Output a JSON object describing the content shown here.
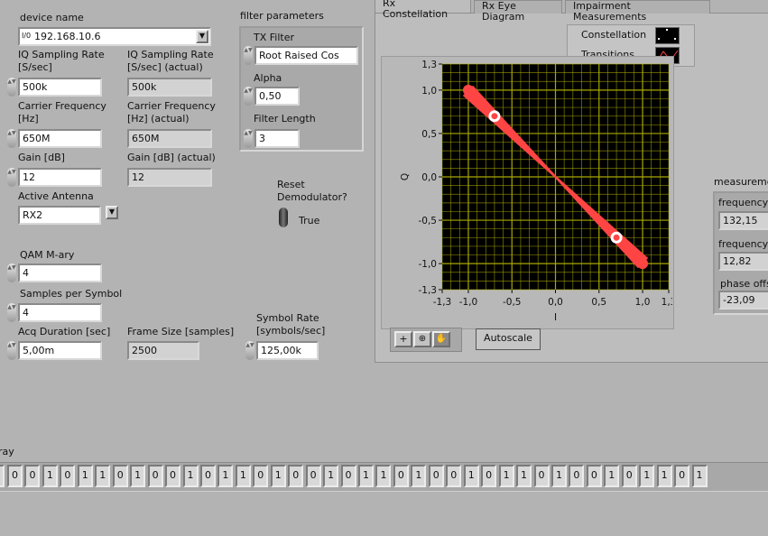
{
  "device": {
    "label": "device name",
    "value": "192.168.10.6",
    "io_icon": "visa-io-icon"
  },
  "iq_rate": {
    "label": "IQ Sampling Rate [S/sec]",
    "value": "500k"
  },
  "iq_rate_actual": {
    "label": "IQ Sampling Rate [S/sec] (actual)",
    "value": "500k"
  },
  "carrier": {
    "label": "Carrier Frequency [Hz]",
    "value": "650M"
  },
  "carrier_actual": {
    "label": "Carrier Frequency [Hz] (actual)",
    "value": "650M"
  },
  "gain": {
    "label": "Gain [dB]",
    "value": "12"
  },
  "gain_actual": {
    "label": "Gain [dB] (actual)",
    "value": "12"
  },
  "antenna": {
    "label": "Active Antenna",
    "value": "RX2"
  },
  "qam": {
    "label": "QAM M-ary",
    "value": "4"
  },
  "sps": {
    "label": "Samples per Symbol",
    "value": "4"
  },
  "acq": {
    "label": "Acq Duration [sec]",
    "value": "5,00m"
  },
  "frame_size": {
    "label": "Frame Size [samples]",
    "value": "2500"
  },
  "symbol_rate": {
    "label": "Symbol Rate [symbols/sec]",
    "value": "125,00k"
  },
  "filter": {
    "label": "filter parameters",
    "tx_label": "TX Filter",
    "tx_value": "Root Raised Cos",
    "alpha_label": "Alpha",
    "alpha_value": "0,50",
    "len_label": "Filter Length",
    "len_value": "3"
  },
  "reset": {
    "label": "Reset Demodulator?",
    "state": "True"
  },
  "tabs": [
    {
      "label": "Rx Constellation",
      "active": true
    },
    {
      "label": "Rx Eye Diagram"
    },
    {
      "label": "Impairment Measurements"
    }
  ],
  "legend": [
    {
      "label": "Constellation",
      "color": "#ffffff"
    },
    {
      "label": "Transitions",
      "color": "#ff4444"
    }
  ],
  "graph": {
    "xlabel": "I",
    "ylabel": "Q",
    "xlim": [
      -1.3,
      1.3
    ],
    "ylim": [
      -1.3,
      1.3
    ],
    "xticks": [
      "-1,3",
      "-1,0",
      "-0,5",
      "0,0",
      "0,5",
      "1,0",
      "1,3"
    ],
    "yticks": [
      "1,3",
      "1,0",
      "0,5",
      "0,0",
      "-0,5",
      "-1,0",
      "-1,3"
    ],
    "tick_values": [
      -1.3,
      -1.0,
      -0.5,
      0,
      0.5,
      1.0,
      1.3
    ],
    "constellation_points": [
      [
        -0.7,
        0.7
      ],
      [
        0.7,
        -0.7
      ]
    ],
    "transition_endpoints": [
      [
        -1.0,
        1.0
      ],
      [
        1.0,
        -1.0
      ]
    ],
    "bg": "#000000",
    "grid_color": "#a8a800",
    "trace_color": "#ff4444",
    "autoscale_label": "Autoscale"
  },
  "measurements": {
    "label": "measureme",
    "items": [
      {
        "label": "frequency",
        "value": "132,15"
      },
      {
        "label": "frequency",
        "value": "12,82"
      },
      {
        "label": "phase offs",
        "value": "-23,09"
      }
    ]
  },
  "bits": {
    "label": "ray",
    "values": [
      0,
      0,
      1,
      0,
      1,
      1,
      0,
      1,
      0,
      0,
      1,
      0,
      1,
      1,
      0,
      1,
      0,
      0,
      1,
      0,
      1,
      1,
      0,
      1,
      0,
      0,
      1,
      0,
      1,
      1,
      0,
      1,
      0,
      0,
      1,
      0,
      1,
      1,
      0,
      1
    ]
  }
}
